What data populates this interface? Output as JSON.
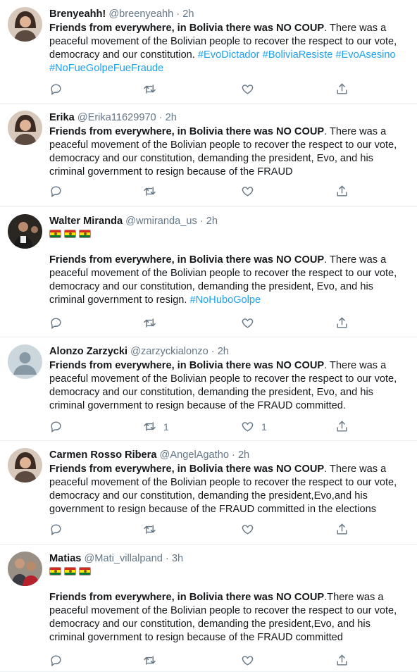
{
  "tweets": [
    {
      "name": "Brenyeahh!",
      "handle": "@breenyeahh",
      "time": "2h",
      "avatar": "woman-portrait",
      "bold": "Friends from everywhere, in Bolivia there was NO COUP",
      "text": ". There was a peaceful movement of the Bolivian people to recover the respect to our vote, democracy and our constitution. ",
      "hashtags": [
        "#EvoDictador",
        "#BoliviaResiste",
        "#EvoAsesino",
        "#NoFueGolpeFueFraude"
      ],
      "retweets": "",
      "likes": ""
    },
    {
      "name": "Erika",
      "handle": "@Erika11629970",
      "time": "2h",
      "avatar": "woman-portrait",
      "bold": "Friends from everywhere, in Bolivia there was NO COUP",
      "text": ". There was a peaceful movement of the Bolivian people to recover the respect to our vote, democracy and our constitution, demanding the president, Evo, and his criminal government to resign because of the FRAUD",
      "hashtags": [],
      "retweets": "",
      "likes": ""
    },
    {
      "name": "Walter Miranda",
      "handle": "@wmiranda_us",
      "time": "2h",
      "avatar": "man-portrait",
      "flags": 3,
      "bold": "Friends from everywhere, in Bolivia there was NO COUP",
      "text": ". There was a peaceful movement of the Bolivian people to recover the respect to our vote, democracy and our constitution, demanding the president, Evo, and his criminal government to resign. ",
      "hashtags": [
        "#NoHuboGolpe"
      ],
      "retweets": "",
      "likes": ""
    },
    {
      "name": "Alonzo Zarzycki",
      "handle": "@zarzyckialonzo",
      "time": "2h",
      "avatar": "default-avatar",
      "bold": "Friends from everywhere, in Bolivia there was NO COUP",
      "text": ". There was a peaceful movement of the Bolivian people to recover the respect to our vote, democracy and our constitution, demanding the president, Evo, and his criminal government to resign because of the FRAUD committed.",
      "hashtags": [],
      "retweets": "1",
      "likes": "1"
    },
    {
      "name": "Carmen Rosso Ribera",
      "handle": "@AngelAgatho",
      "time": "2h",
      "avatar": "woman-portrait",
      "bold": "Friends from everywhere, in Bolivia there was NO COUP",
      "text": ". There was a peaceful movement of the Bolivian people to recover the respect to our vote, democracy and our constitution, demanding the president,Evo,and his government to resign because of the FRAUD committed in the elections",
      "hashtags": [],
      "retweets": "",
      "likes": ""
    },
    {
      "name": "Matias",
      "handle": "@Mati_villalpand",
      "time": "3h",
      "avatar": "two-people-portrait",
      "flags": 3,
      "bold": "Friends from everywhere, in Bolivia there was NO COUP",
      "text": ".There was a peaceful movement of the Bolivian people to recover the respect to our vote, democracy and our constitution, demanding the president,Evo, and his criminal government to resign because of the FRAUD committed",
      "hashtags": [],
      "retweets": "",
      "likes": ""
    }
  ],
  "icons": {
    "reply": "reply-icon",
    "retweet": "retweet-icon",
    "like": "like-icon",
    "share": "share-icon"
  },
  "colors": {
    "hashtag": "#1da1f2",
    "secondary_text": "#657786",
    "divider": "#e6ecf0"
  }
}
